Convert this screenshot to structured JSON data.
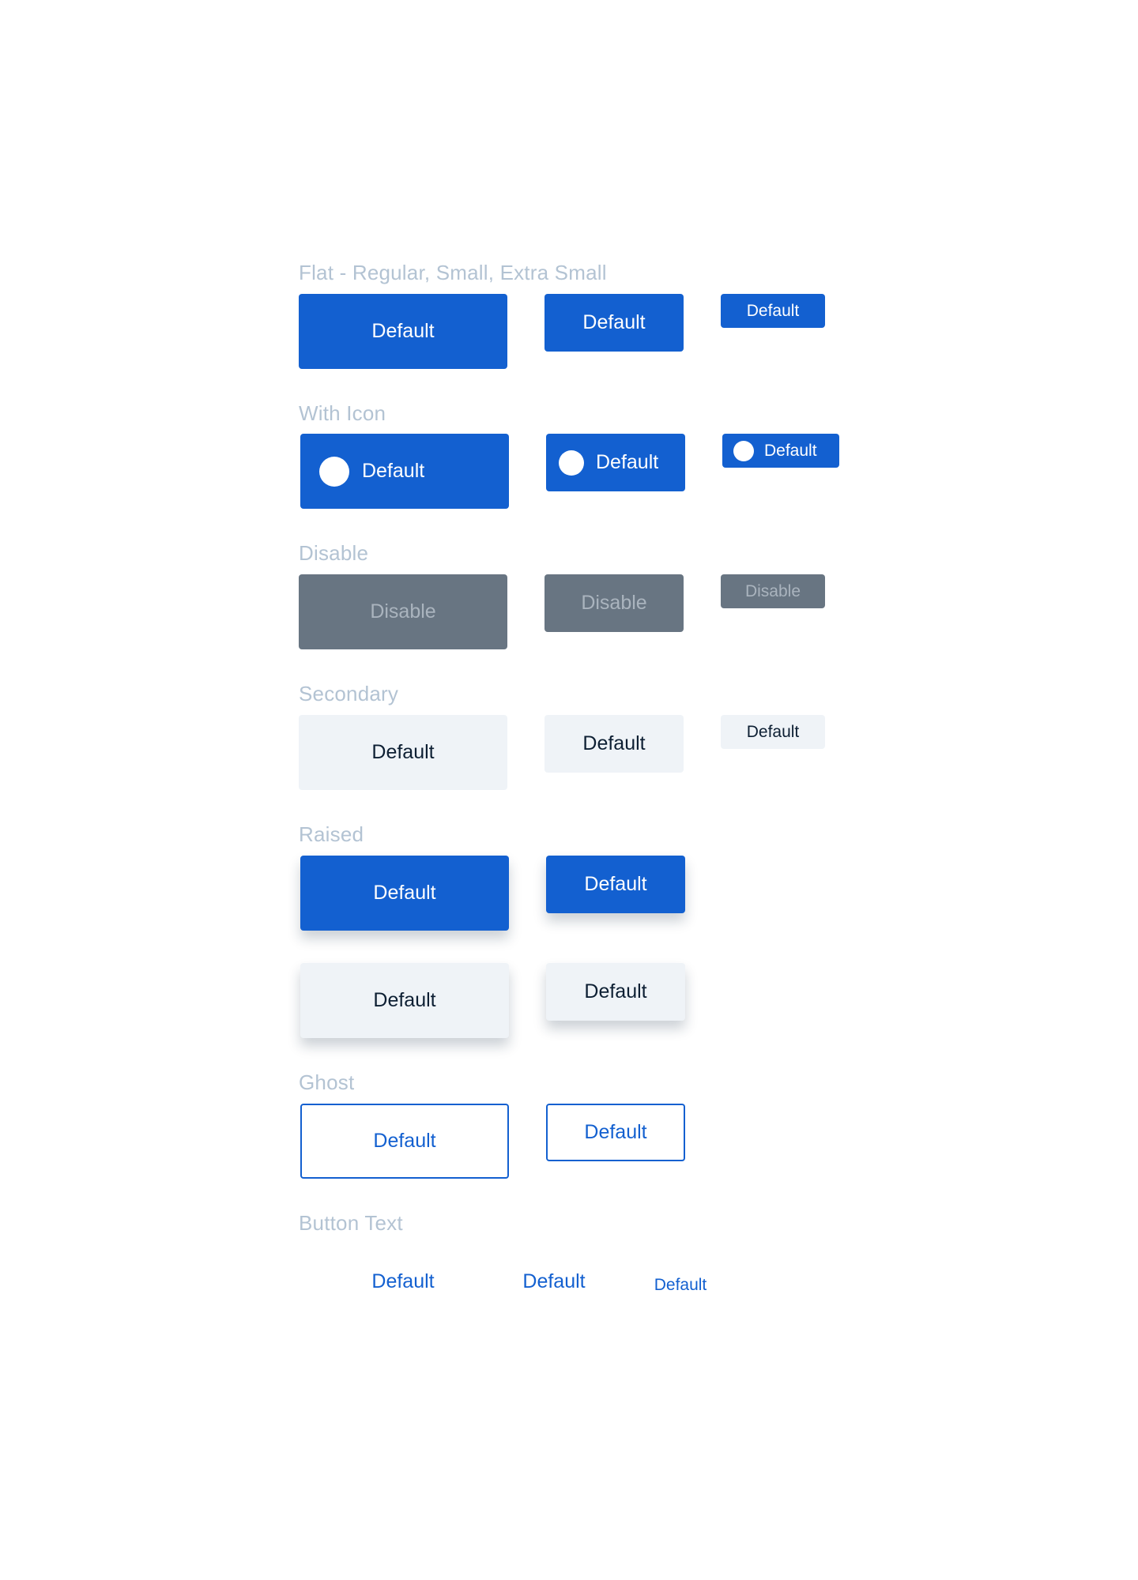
{
  "colors": {
    "primary": "#1360d0",
    "disabled": "#687582",
    "disabled_text": "#aab4be",
    "secondary": "#eff3f7",
    "secondary_text": "#0d1f33",
    "section_label": "#b3c3d3"
  },
  "sections": {
    "flat": {
      "label": "Flat - Regular, Small, Extra Small",
      "regular": "Default",
      "small": "Default",
      "extra_small": "Default"
    },
    "with_icon": {
      "label": "With Icon",
      "icon": "circle-icon",
      "regular": "Default",
      "small": "Default",
      "extra_small": "Default"
    },
    "disable": {
      "label": "Disable",
      "regular": "Disable",
      "small": "Disable",
      "extra_small": "Disable"
    },
    "secondary": {
      "label": "Secondary",
      "regular": "Default",
      "small": "Default",
      "extra_small": "Default"
    },
    "raised": {
      "label": "Raised",
      "primary_regular": "Default",
      "primary_small": "Default",
      "secondary_regular": "Default",
      "secondary_small": "Default"
    },
    "ghost": {
      "label": "Ghost",
      "regular": "Default",
      "small": "Default"
    },
    "button_text": {
      "label": "Button Text",
      "regular": "Default",
      "small": "Default",
      "extra_small": "Default"
    }
  }
}
